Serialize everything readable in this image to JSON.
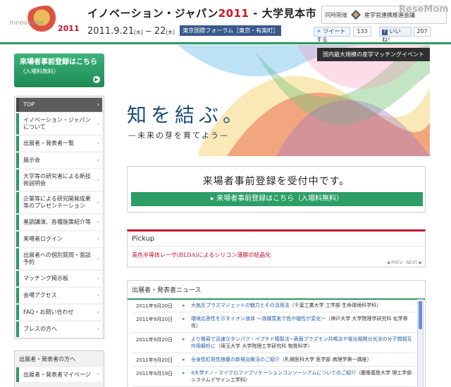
{
  "header": {
    "logo_line1": "Innovation",
    "logo_line2": "JAPAN",
    "logo_year": "2011",
    "title": "イノベーション・ジャパン",
    "title_year": "2011",
    "title_suffix": " - 大学見本市",
    "date_start": "2011.9.21",
    "date_start_dow": "[水]",
    "date_sep": " − ",
    "date_end": "22",
    "date_end_dow": "[木]",
    "venue": "東京国際フォーラム［東京・有楽町］",
    "sponsor_label": "同時開催",
    "sponsor_name": "産学官連携推進会議",
    "watermark": "ReseMom",
    "tweet_label": "ツイートする",
    "tweet_count": "133",
    "like_label": "いいね！",
    "like_count": "207"
  },
  "sidebar": {
    "register_line1": "来場者事前登録はこちら",
    "register_line2": "（入場料無料）",
    "nav": [
      {
        "label": "TOP"
      },
      {
        "label": "イノベーション・ジャパンについて"
      },
      {
        "label": "出展者・発表者一覧"
      },
      {
        "label": "展示会"
      },
      {
        "label": "大学等の研究者による新技術説明会"
      },
      {
        "label": "企業等による研究開発成果等のプレゼンテーション"
      },
      {
        "label": "基調講演、各種施策紹介等"
      },
      {
        "label": "来場者ログイン"
      },
      {
        "label": "出展者への個別質問・面談予約"
      },
      {
        "label": "マッチング掲示板"
      },
      {
        "label": "会場アクセス"
      },
      {
        "label": "FAQ・お問い合わせ"
      },
      {
        "label": "プレスの方へ"
      }
    ],
    "exhibitor_heading": "出展者・発表者の方へ",
    "exhibitor_item": "出展者・発表者マイページ"
  },
  "hero": {
    "tagline": "国内最大規模の産学マッチングイベント",
    "headline": "知を結ぶ。",
    "subline": "—未来の芽を育てよう—"
  },
  "registration": {
    "heading": "来場者事前登録を受付中です。",
    "button": "▸ 来場者事前登録はこちら（入場料無料）"
  },
  "pickup": {
    "heading": "Pickup",
    "item": "青色半導体レーザ(BLDA)によるシリコン薄膜の結晶化",
    "pager": "◀ PREV · NEXT ▶"
  },
  "news": {
    "heading": "出展者・発表者ニュース",
    "items": [
      {
        "date": "2011年9月20日",
        "link": "大気圧プラズマジェットの魅力とその活用法",
        "org": "（千葉工業大学 工学部 生命環境科学科）"
      },
      {
        "date": "2011年9月20日",
        "link": "環境応答性を示すイオン液体 〜溶媒蒸気で色や磁性が変化〜",
        "org": "（神戸大学 大学院理学研究科 化学専攻）"
      },
      {
        "date": "2011年9月20日",
        "link": "より簡易で迅速なタンパク・ペプチド精製法−表面プラズモン共鳴法や蛍光相関分光法の分子間相互作用解析に",
        "org": "（埼玉大学 大学院理工学研究科 物質科学）"
      },
      {
        "date": "2011年9月20日",
        "link": "全身性紅斑性狼瘡の新規治療法のご紹介",
        "org": "（札幌医科大学 医学部 病理学第一講座）"
      },
      {
        "date": "2011年9月19日",
        "link": "4大学ナノ・マイクロファブリケーションコンソーシアムについてのご紹介",
        "org": "（慶應義塾大学 理工学部 システムデザイン工学科）"
      }
    ]
  },
  "colors": {
    "accent_green": "#2a9a62",
    "accent_red": "#c8102e",
    "link_blue": "#1f56a8"
  }
}
